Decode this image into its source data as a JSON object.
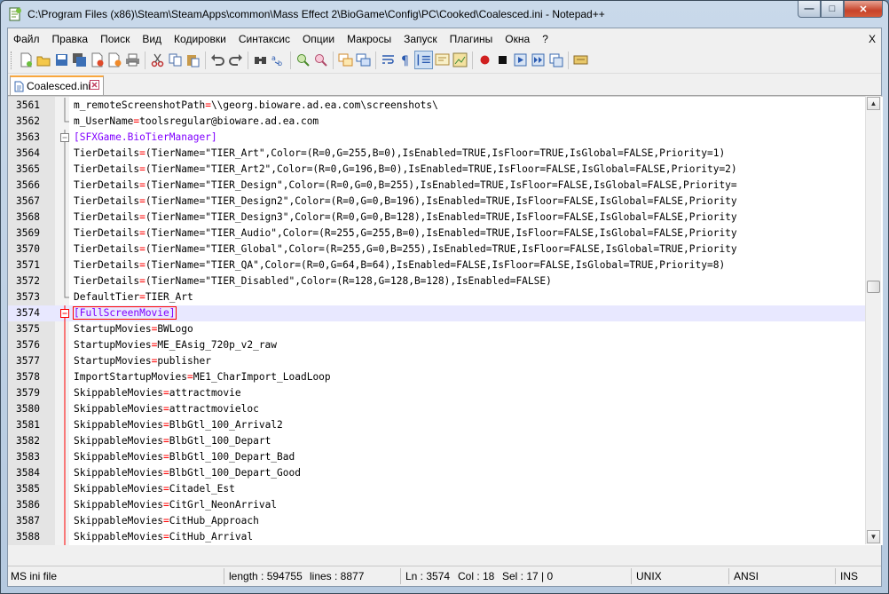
{
  "window": {
    "title": "C:\\Program Files (x86)\\Steam\\SteamApps\\common\\Mass Effect 2\\BioGame\\Config\\PC\\Cooked\\Coalesced.ini - Notepad++",
    "minimize": "—",
    "maximize": "□",
    "close": "✕"
  },
  "menu": {
    "items": [
      "Файл",
      "Правка",
      "Поиск",
      "Вид",
      "Кодировки",
      "Синтаксис",
      "Опции",
      "Макросы",
      "Запуск",
      "Плагины",
      "Окна",
      "?"
    ],
    "close_doc": "X"
  },
  "tab": {
    "label": "Coalesced.ini"
  },
  "editor": {
    "lines": [
      {
        "n": "3561",
        "key": "m_remoteScreenshotPath",
        "val": "\\\\georg.bioware.ad.ea.com\\screenshots\\"
      },
      {
        "n": "3562",
        "key": "m_UserName",
        "val": "toolsregular@bioware.ad.ea.com"
      },
      {
        "n": "3563",
        "section": "[SFXGame.BioTierManager]"
      },
      {
        "n": "3564",
        "key": "TierDetails",
        "val": "(TierName=\"TIER_Art\",Color=(R=0,G=255,B=0),IsEnabled=TRUE,IsFloor=TRUE,IsGlobal=FALSE,Priority=1)"
      },
      {
        "n": "3565",
        "key": "TierDetails",
        "val": "(TierName=\"TIER_Art2\",Color=(R=0,G=196,B=0),IsEnabled=TRUE,IsFloor=FALSE,IsGlobal=FALSE,Priority=2)"
      },
      {
        "n": "3566",
        "key": "TierDetails",
        "val": "(TierName=\"TIER_Design\",Color=(R=0,G=0,B=255),IsEnabled=TRUE,IsFloor=FALSE,IsGlobal=FALSE,Priority="
      },
      {
        "n": "3567",
        "key": "TierDetails",
        "val": "(TierName=\"TIER_Design2\",Color=(R=0,G=0,B=196),IsEnabled=TRUE,IsFloor=FALSE,IsGlobal=FALSE,Priority"
      },
      {
        "n": "3568",
        "key": "TierDetails",
        "val": "(TierName=\"TIER_Design3\",Color=(R=0,G=0,B=128),IsEnabled=TRUE,IsFloor=FALSE,IsGlobal=FALSE,Priority"
      },
      {
        "n": "3569",
        "key": "TierDetails",
        "val": "(TierName=\"TIER_Audio\",Color=(R=255,G=255,B=0),IsEnabled=TRUE,IsFloor=FALSE,IsGlobal=FALSE,Priority"
      },
      {
        "n": "3570",
        "key": "TierDetails",
        "val": "(TierName=\"TIER_Global\",Color=(R=255,G=0,B=255),IsEnabled=TRUE,IsFloor=FALSE,IsGlobal=TRUE,Priority"
      },
      {
        "n": "3571",
        "key": "TierDetails",
        "val": "(TierName=\"TIER_QA\",Color=(R=0,G=64,B=64),IsEnabled=FALSE,IsFloor=FALSE,IsGlobal=TRUE,Priority=8)"
      },
      {
        "n": "3572",
        "key": "TierDetails",
        "val": "(TierName=\"TIER_Disabled\",Color=(R=128,G=128,B=128),IsEnabled=FALSE)"
      },
      {
        "n": "3573",
        "key": "DefaultTier",
        "val": "TIER_Art"
      },
      {
        "n": "3574",
        "section": "[FullScreenMovie]",
        "current": true
      },
      {
        "n": "3575",
        "key": "StartupMovies",
        "val": "BWLogo"
      },
      {
        "n": "3576",
        "key": "StartupMovies",
        "val": "ME_EAsig_720p_v2_raw"
      },
      {
        "n": "3577",
        "key": "StartupMovies",
        "val": "publisher"
      },
      {
        "n": "3578",
        "key": "ImportStartupMovies",
        "val": "ME1_CharImport_LoadLoop"
      },
      {
        "n": "3579",
        "key": "SkippableMovies",
        "val": "attractmovie"
      },
      {
        "n": "3580",
        "key": "SkippableMovies",
        "val": "attractmovieloc"
      },
      {
        "n": "3581",
        "key": "SkippableMovies",
        "val": "BlbGtl_100_Arrival2"
      },
      {
        "n": "3582",
        "key": "SkippableMovies",
        "val": "BlbGtl_100_Depart"
      },
      {
        "n": "3583",
        "key": "SkippableMovies",
        "val": "BlbGtl_100_Depart_Bad"
      },
      {
        "n": "3584",
        "key": "SkippableMovies",
        "val": "BlbGtl_100_Depart_Good"
      },
      {
        "n": "3585",
        "key": "SkippableMovies",
        "val": "Citadel_Est"
      },
      {
        "n": "3586",
        "key": "SkippableMovies",
        "val": "CitGrl_NeonArrival"
      },
      {
        "n": "3587",
        "key": "SkippableMovies",
        "val": "CitHub_Approach"
      },
      {
        "n": "3588",
        "key": "SkippableMovies",
        "val": "CitHub_Arrival"
      }
    ]
  },
  "status": {
    "type": "MS ini file",
    "length": "length : 594755",
    "lines": "lines : 8877",
    "ln": "Ln : 3574",
    "col": "Col : 18",
    "sel": "Sel : 17 | 0",
    "eol": "UNIX",
    "encoding": "ANSI",
    "mode": "INS"
  },
  "colors": {
    "key": "#000000",
    "operator": "#ff0000",
    "section": "#8000ff",
    "fold_line": "#ff0000",
    "tab_accent": "#f9a73e"
  }
}
